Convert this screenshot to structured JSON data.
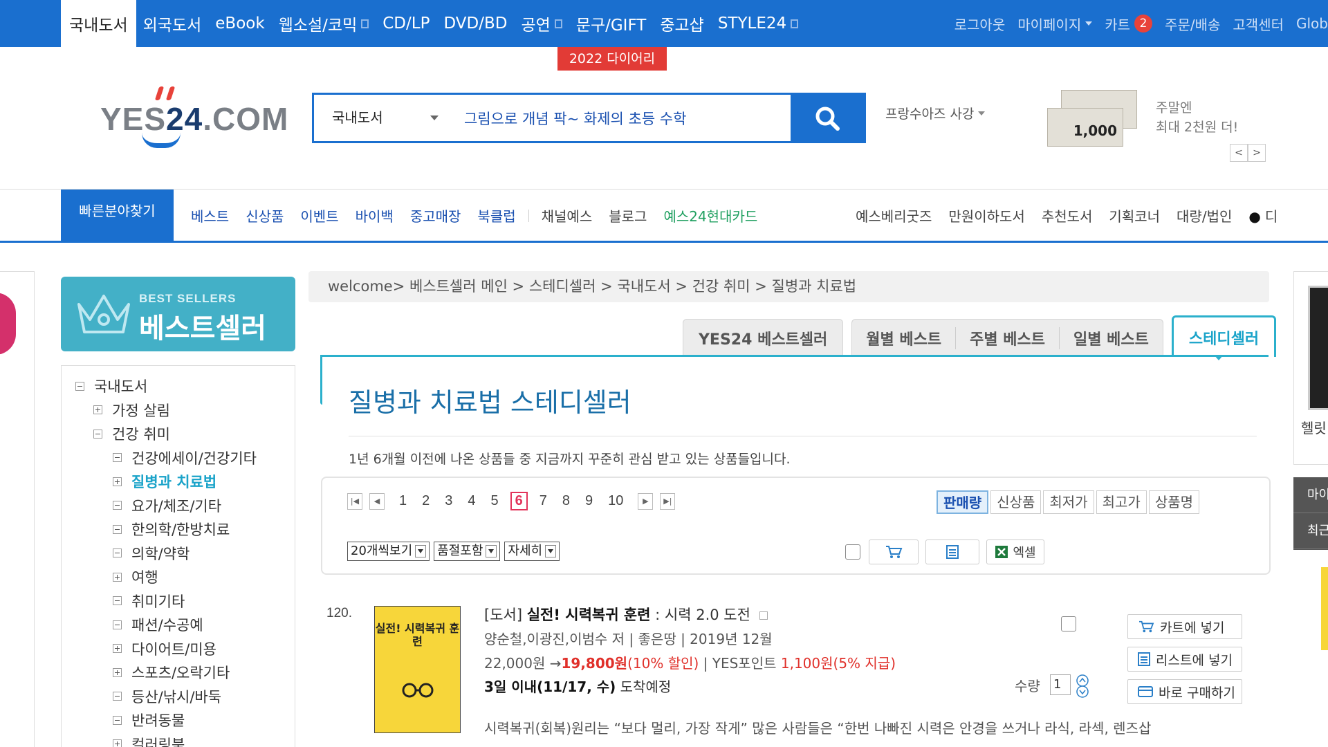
{
  "gnb": {
    "items": [
      {
        "label": "국내도서",
        "active": true
      },
      {
        "label": "외국도서"
      },
      {
        "label": "eBook"
      },
      {
        "label": "웹소설/코믹",
        "ext": true
      },
      {
        "label": "CD/LP"
      },
      {
        "label": "DVD/BD"
      },
      {
        "label": "공연",
        "ext": true
      },
      {
        "label": "문구/GIFT"
      },
      {
        "label": "중고샵"
      },
      {
        "label": "STYLE24",
        "ext": true
      }
    ],
    "right": {
      "logout": "로그아웃",
      "mypage": "마이페이지",
      "cart": "카트",
      "cart_count": "2",
      "orders": "주문/배송",
      "service": "고객센터",
      "global": "Glob"
    },
    "promo_tag": "2022 다이어리"
  },
  "header": {
    "logo_text_left": "YES",
    "logo_text_mid": "24",
    "logo_text_right": ".COM",
    "search": {
      "category": "국내도서",
      "value": "그림으로 개념 팍~ 화제의 초등 수학"
    },
    "keyword_roll": "프랑수아즈 사강",
    "ad": {
      "ticket_amount": "1,000",
      "line1": "주말엔",
      "line2": "최대 2천원 더!",
      "prev": "<",
      "next": ">"
    }
  },
  "catbar": {
    "quick": "빠른분야찾기",
    "left": [
      "베스트",
      "신상품",
      "이벤트",
      "바이백",
      "중고매장",
      "북클럽"
    ],
    "left2": [
      "채널예스",
      "블로그"
    ],
    "card": "예스24현대카드",
    "right": [
      "예스베리굿즈",
      "만원이하도서",
      "추천도서",
      "기획코너",
      "대량/법인"
    ],
    "far_right": "디"
  },
  "sidebar": {
    "logo_sub": "BEST SELLERS",
    "logo_title": "베스트셀러",
    "tree": [
      {
        "label": "국내도서",
        "level": 0,
        "open": true
      },
      {
        "label": "가정 살림",
        "level": 1,
        "open": false
      },
      {
        "label": "건강 취미",
        "level": 1,
        "open": true
      },
      {
        "label": "건강에세이/건강기타",
        "level": 2,
        "open": true
      },
      {
        "label": "질병과 치료법",
        "level": 2,
        "open": false,
        "active": true
      },
      {
        "label": "요가/체조/기타",
        "level": 2,
        "open": true
      },
      {
        "label": "한의학/한방치료",
        "level": 2,
        "open": true
      },
      {
        "label": "의학/약학",
        "level": 2,
        "open": true
      },
      {
        "label": "여행",
        "level": 2,
        "open": false
      },
      {
        "label": "취미기타",
        "level": 2,
        "open": true
      },
      {
        "label": "패션/수공예",
        "level": 2,
        "open": true
      },
      {
        "label": "다이어트/미용",
        "level": 2,
        "open": false
      },
      {
        "label": "스포츠/오락기타",
        "level": 2,
        "open": false
      },
      {
        "label": "등산/낚시/바둑",
        "level": 2,
        "open": true
      },
      {
        "label": "반려동물",
        "level": 2,
        "open": true
      },
      {
        "label": "컬러링북",
        "level": 2,
        "open": false
      }
    ]
  },
  "main": {
    "breadcrumb": "welcome> 베스트셀러 메인 > 스테디셀러 > 국내도서 > 건강 취미 > 질병과 치료법",
    "tabs": {
      "yes24": "YES24 베스트셀러",
      "monthly": "월별 베스트",
      "weekly": "주별 베스트",
      "daily": "일별 베스트",
      "steady": "스테디셀러"
    },
    "title": "질병과 치료법 스테디셀러",
    "desc": "1년 6개월 이전에 나온 상품들 중 지금까지 꾸준히 관심 받고 있는 상품들입니다.",
    "pager": {
      "pages": [
        "1",
        "2",
        "3",
        "4",
        "5",
        "6",
        "7",
        "8",
        "9",
        "10"
      ],
      "current": "6"
    },
    "sort": [
      "판매량",
      "신상품",
      "최저가",
      "최고가",
      "상품명"
    ],
    "sort_active": "판매량",
    "view": {
      "per_page": "20개씩보기",
      "soldout": "품절포함",
      "detail": "자세히"
    },
    "excel": "엑셀"
  },
  "item": {
    "rank": "120.",
    "cover_title": "실전! 시력복귀 훈련",
    "category_tag": "[도서]",
    "title_bold": "실전! 시력복귀 훈련",
    "subtitle": " : 시력 2.0 도전",
    "meta": "양순철,이광진,이범수 저 | 좋은땅 | 2019년 12월",
    "price_orig": "22,000원 →",
    "price_sale": "19,800원",
    "discount": "(10% 할인)",
    "point_label": " | YES포인트 ",
    "point_value": "1,100원",
    "point_rate": "(5% 지급)",
    "delivery_bold": "3일 이내(11/17, 수)",
    "delivery_rest": " 도착예정",
    "qty_label": "수량",
    "qty_value": "1",
    "btn_cart": "카트에 넣기",
    "btn_list": "리스트에 넣기",
    "btn_buy": "바로 구매하기",
    "desc": "시력복귀(회복)원리는 “보다 멀리, 가장 작게” 많은 사람들은 “한번 나빠진 시력은 안경을 쓰거나 라식, 라섹, 렌즈삽"
  },
  "right_edge": {
    "label": "헬릿",
    "dark1": "마이",
    "dark2": "최근"
  },
  "colors": {
    "brand": "#1a6fcf",
    "accent": "#2bb0cc",
    "sale": "#e0302a"
  }
}
